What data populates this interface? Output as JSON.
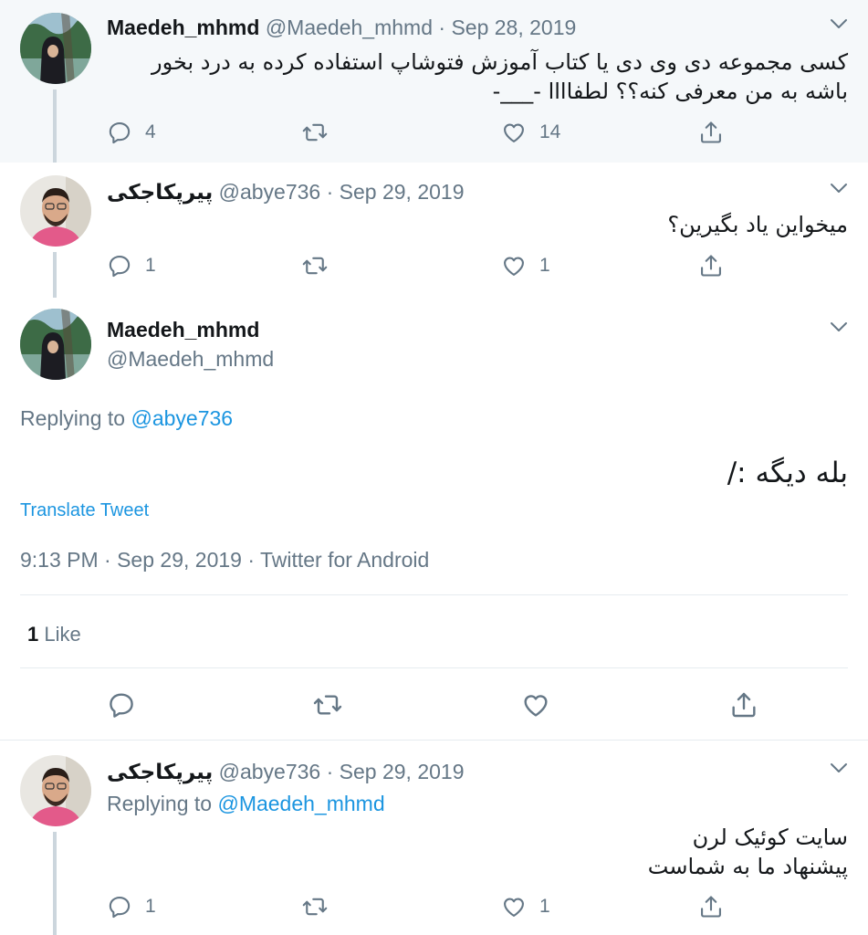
{
  "tweets": [
    {
      "name": "Maedeh_mhmd",
      "handle": "@Maedeh_mhmd",
      "date": "Sep 28, 2019",
      "text": "کسی مجموعه دی وی دی یا کتاب آموزش فتوشاپ استفاده کرده به درد بخور باشه به من معرفی کنه؟؟ لطفاااا -___-",
      "replies": "4",
      "retweets": "",
      "likes": "14"
    },
    {
      "name": "پیرپکاجکی",
      "handle": "@abye736",
      "date": "Sep 29, 2019",
      "text": "میخواین یاد بگیرین؟",
      "replies": "1",
      "retweets": "",
      "likes": "1"
    },
    {
      "name": "پیرپکاجکی",
      "handle": "@abye736",
      "date": "Sep 29, 2019",
      "replying_label": "Replying to",
      "replying_handle": "@Maedeh_mhmd",
      "text_line1": "سایت کوئیک لرن",
      "text_line2": "پیشنهاد ما به شماست",
      "replies": "1",
      "retweets": "",
      "likes": "1"
    }
  ],
  "main": {
    "name": "Maedeh_mhmd",
    "handle": "@Maedeh_mhmd",
    "replying_label": "Replying to",
    "replying_handle": "@abye736",
    "text": "بله دیگه :/",
    "translate": "Translate Tweet",
    "timestamp": "9:13 PM · Sep 29, 2019 · Twitter for Android",
    "like_count": "1",
    "like_label": "Like"
  },
  "meta_sep": "·",
  "colors": {
    "accent": "#1b95e0",
    "muted": "#657786",
    "thread": "#ccd6dd",
    "shade": "#f5f8fa"
  },
  "icons": [
    "reply-icon",
    "retweet-icon",
    "like-icon",
    "share-icon",
    "chevron-down-icon"
  ]
}
